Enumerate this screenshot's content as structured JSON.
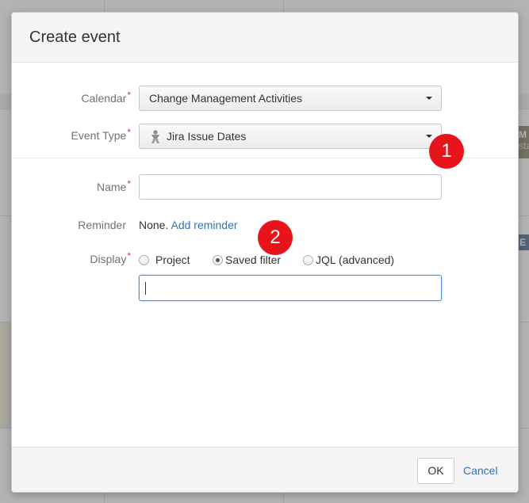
{
  "dialog": {
    "title": "Create event"
  },
  "form": {
    "calendar": {
      "label": "Calendar",
      "required_mark": "*",
      "value": "Change Management Activities"
    },
    "event_type": {
      "label": "Event Type",
      "required_mark": "*",
      "value": "Jira Issue Dates",
      "icon": "jira-icon"
    },
    "name": {
      "label": "Name",
      "required_mark": "*",
      "value": ""
    },
    "reminder": {
      "label": "Reminder",
      "value": "None.",
      "link": "Add reminder"
    },
    "display": {
      "label": "Display",
      "required_mark": "*",
      "options": [
        {
          "label": "Project",
          "checked": false
        },
        {
          "label": "Saved filter",
          "checked": true
        },
        {
          "label": "JQL (advanced)",
          "checked": false
        }
      ],
      "filter_value": ""
    }
  },
  "footer": {
    "ok_label": "OK",
    "cancel_label": "Cancel"
  },
  "annotations": [
    {
      "label": "1"
    },
    {
      "label": "2"
    }
  ],
  "background": {
    "tag1_title": "M",
    "tag1_sub": "sta",
    "tag2_title": "E"
  },
  "colors": {
    "annotation_red": "#e8141c",
    "link_blue": "#3572b0",
    "required_red": "#d04437",
    "focus_blue": "#4a90d9"
  }
}
